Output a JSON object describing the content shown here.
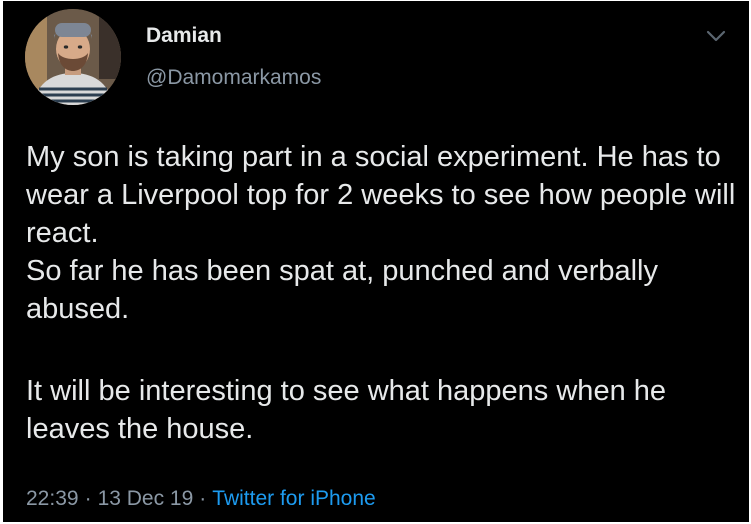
{
  "tweet": {
    "author": {
      "display_name": "Damian",
      "handle": "@Damomarkamos"
    },
    "paragraphs": [
      "My son is taking part in a social experiment. He has to wear a Liverpool top for 2 weeks to see how people will react.",
      "So far he has been spat at, punched and verbally abused.",
      "It will be interesting to see what happens when he leaves the house."
    ],
    "meta": {
      "time": "22:39",
      "separator": "·",
      "date": "13 Dec 19",
      "source": "Twitter for iPhone"
    }
  },
  "icons": {
    "menu": "chevron-down-icon",
    "avatar": "avatar"
  },
  "colors": {
    "background": "#000000",
    "text": "#e7e9ea",
    "muted": "#8b98a5",
    "link": "#1d9bf0"
  }
}
